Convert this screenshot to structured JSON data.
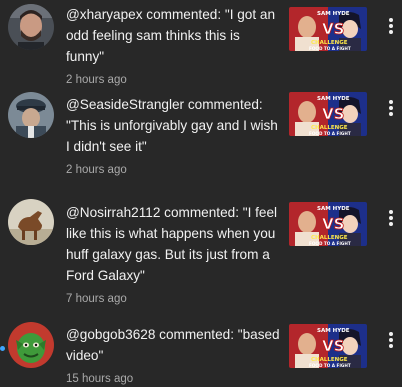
{
  "notifications": [
    {
      "text": "@xharyapex commented: \"I got an odd feeling sam thinks this is funny\"",
      "time": "2 hours ago",
      "avatar": "avatar-man-with-beard",
      "unread": false
    },
    {
      "text": "@SeasideStrangler commented: \"This is unforgivably gay and I wish I didn't see it\"",
      "time": "2 hours ago",
      "avatar": "avatar-officer-in-cap",
      "unread": false
    },
    {
      "text": "@Nosirrah2112 commented: \"I feel like this is what happens when you huff galaxy gas. But its just from a Ford Galaxy\"",
      "time": "7 hours ago",
      "avatar": "avatar-horse",
      "unread": false
    },
    {
      "text": "@gobgob3628 commented: \"based video\"",
      "time": "15 hours ago",
      "avatar": "avatar-green-goblin",
      "unread": true
    }
  ],
  "thumbnail": {
    "top_text": "SAM HYDE",
    "vs_text": "VS",
    "bottom_text": "CHALLENGE",
    "sub_text": "FOOD TO A FIGHT"
  },
  "colors": {
    "background": "#282828",
    "text_primary": "#f1f1f1",
    "text_secondary": "#aaaaaa",
    "unread_dot": "#3ea6ff"
  },
  "icons": {
    "more": "more-vert-icon"
  }
}
